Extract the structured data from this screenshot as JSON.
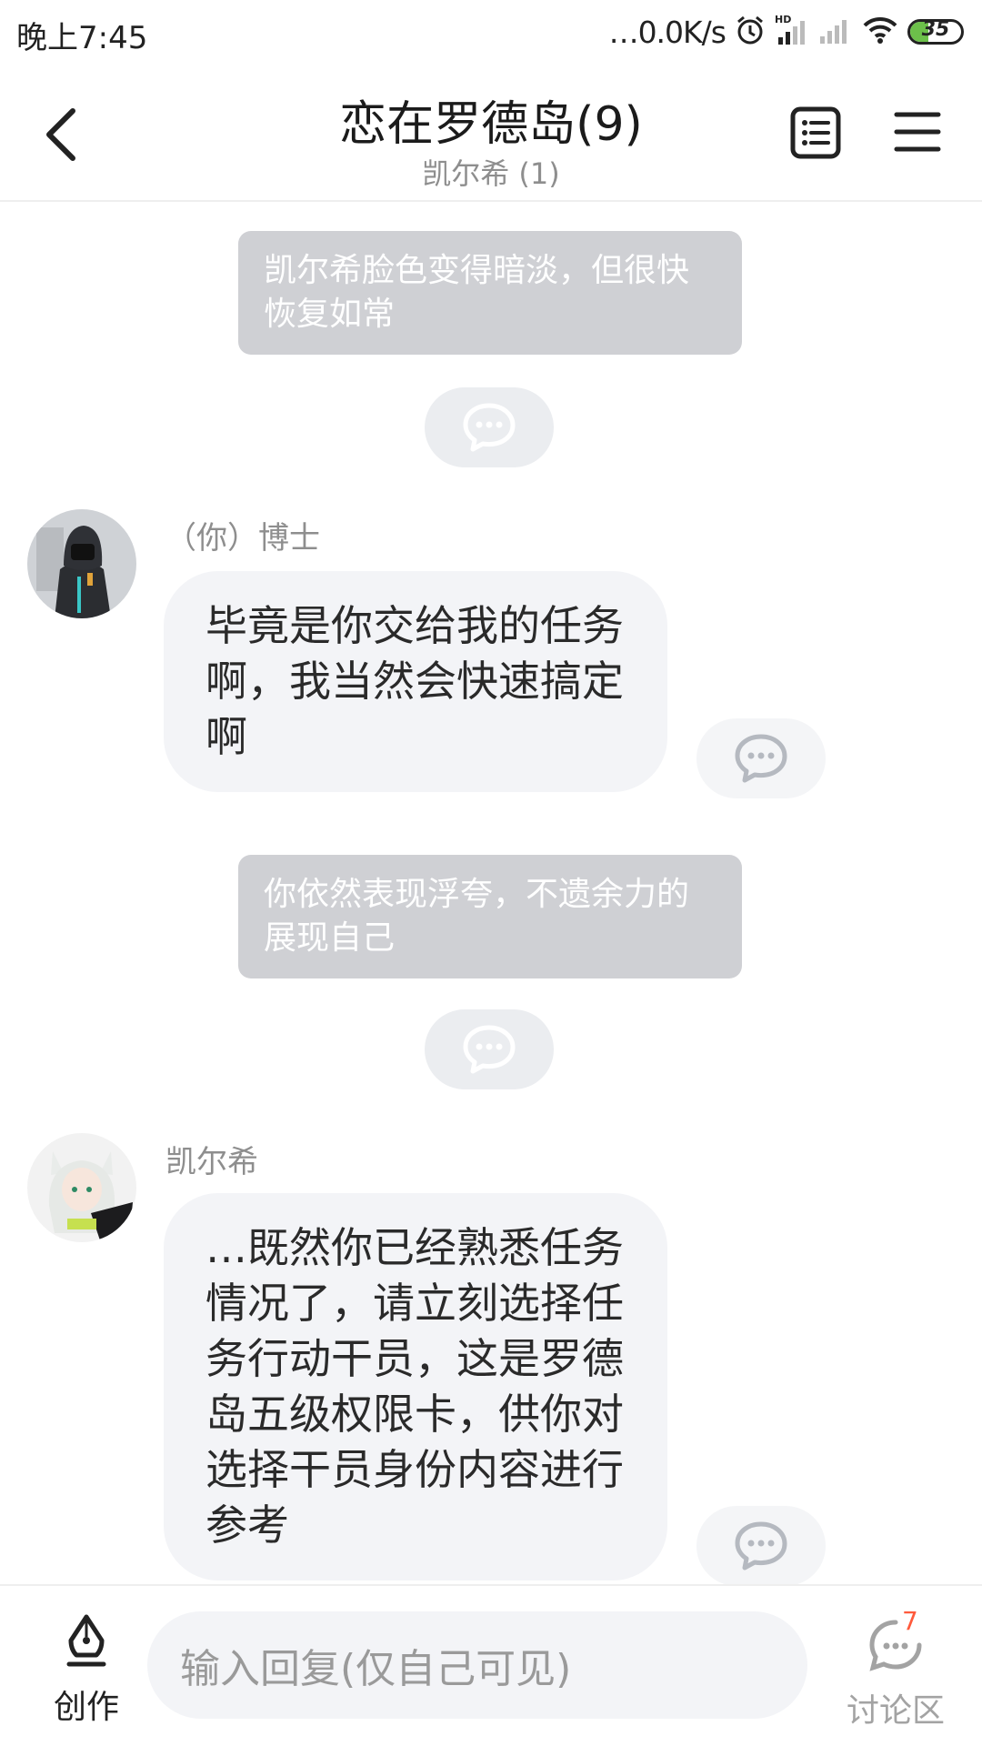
{
  "status_bar": {
    "time": "晚上7:45",
    "speed": "…0.0K/s",
    "battery": "35",
    "battery_level": 0.35,
    "icons": [
      "alarm-icon",
      "hd-signal-icon",
      "signal-icon",
      "wifi-icon",
      "battery-icon"
    ]
  },
  "header": {
    "title": "恋在罗德岛(9)",
    "subtitle": "凯尔希 (1)",
    "icons": [
      "back-arrow-icon",
      "notes-list-icon",
      "menu-icon"
    ]
  },
  "messages": [
    {
      "type": "narration",
      "text": "凯尔希脸色变得暗淡，但很快恢复如常"
    },
    {
      "type": "chat",
      "sender": "（你）博士",
      "text": "毕竟是你交给我的任务啊，我当然会快速搞定啊"
    },
    {
      "type": "narration",
      "text": "你依然表现浮夸，不遗余力的展现自己"
    },
    {
      "type": "chat",
      "sender": "凯尔希",
      "text": "…既然你已经熟悉任务情况了，请立刻选择任务行动干员，这是罗德岛五级权限卡，供你对选择干员身份内容进行参考"
    }
  ],
  "bottom_bar": {
    "create_label": "创作",
    "reply_placeholder": "输入回复(仅自己可见)",
    "discuss_label": "讨论区",
    "discuss_badge": "7"
  },
  "colors": {
    "narration_bg": "#cfd0d4",
    "bubble_bg": "#f3f4f7",
    "badge": "#ff5a3c",
    "battery": "#6cc04a"
  }
}
